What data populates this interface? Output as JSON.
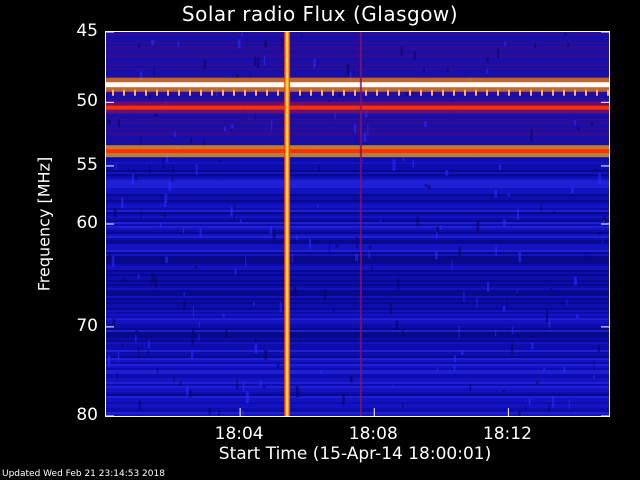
{
  "chart_data": {
    "type": "heatmap",
    "title": "Solar radio Flux (Glasgow)",
    "ylabel": "Frequency [MHz]",
    "xlabel": "Start Time (15-Apr-14 18:00:01)",
    "x_range_minutes": [
      0,
      15
    ],
    "y_range_mhz": [
      45,
      80
    ],
    "y_scale": "log",
    "y_inverted": true,
    "x_ticks": [
      {
        "minute": 4,
        "label": "18:04"
      },
      {
        "minute": 8,
        "label": "18:08"
      },
      {
        "minute": 12,
        "label": "18:12"
      }
    ],
    "y_ticks": [
      {
        "mhz": 45,
        "label": "45"
      },
      {
        "mhz": 50,
        "label": "50"
      },
      {
        "mhz": 55,
        "label": "55"
      },
      {
        "mhz": 60,
        "label": "60"
      },
      {
        "mhz": 70,
        "label": "70"
      },
      {
        "mhz": 80,
        "label": "80"
      }
    ],
    "bright_bands_mhz": [
      48.7,
      50.4,
      53.8
    ],
    "burst_times_minutes": [
      5.4,
      7.6
    ],
    "colors": {
      "background": "#0c0ca0",
      "strong": "#ffffff",
      "medium": "#ff3000",
      "weak": "#8a1060"
    }
  },
  "footer": "Updated Wed Feb 21 23:14:53 2018"
}
